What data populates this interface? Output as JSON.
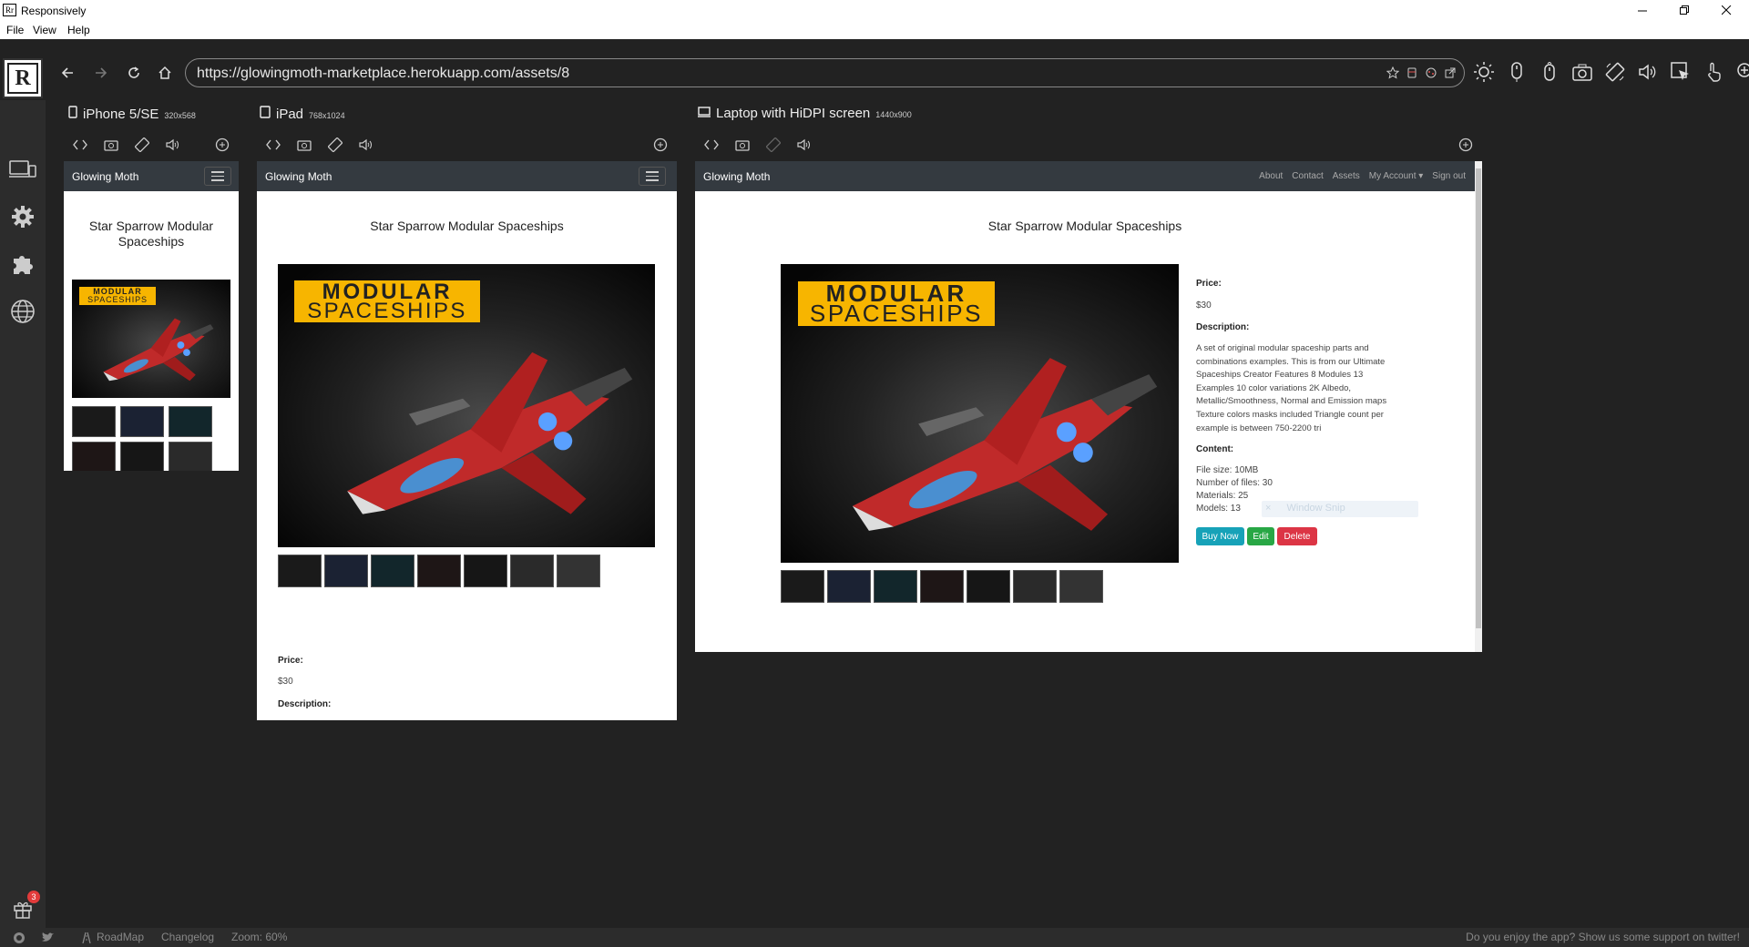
{
  "window": {
    "title": "Responsively",
    "app_icon_text": "Rr",
    "menu": [
      "File",
      "View",
      "Help"
    ]
  },
  "browser": {
    "url": "https://glowingmoth-marketplace.herokuapp.com/assets/8"
  },
  "status": {
    "roadmap": "RoadMap",
    "changelog": "Changelog",
    "zoom": "Zoom: 60%",
    "support": "Do you enjoy the app? Show us some support on twitter!"
  },
  "sidebar": {
    "gift_badge": "3"
  },
  "devices": [
    {
      "name": "iPhone 5/SE",
      "size": "320x568"
    },
    {
      "name": "iPad",
      "size": "768x1024"
    },
    {
      "name": "Laptop with HiDPI screen",
      "size": "1440x900"
    }
  ],
  "site": {
    "brand": "Glowing Moth",
    "nav_links": [
      "About",
      "Contact",
      "Assets",
      "My Account",
      "Sign out"
    ],
    "asset_title": "Star Sparrow Modular Spaceships",
    "banner_line1": "MODULAR",
    "banner_line2": "SPACESHIPS",
    "price_label": "Price:",
    "price": "$30",
    "description_label": "Description:",
    "description": "A set of original modular spaceship parts and combinations examples. This is from our Ultimate Spaceships Creator Features 8 Modules 13 Examples 10 color variations 2K Albedo, Metallic/Smoothness, Normal and Emission maps Texture colors masks included Triangle count per example is between 750-2200 tri",
    "content_label": "Content:",
    "file_size": "File size: 10MB",
    "num_files": "Number of files: 30",
    "materials": "Materials: 25",
    "models": "Models: 13",
    "window_snip": "Window Snip",
    "buy_label": "Buy Now",
    "edit_label": "Edit",
    "delete_label": "Delete"
  },
  "colors": {
    "navbar": "#343a40",
    "buy": "#17a2b8",
    "edit": "#28a745",
    "delete": "#dc3545",
    "banner": "#f7b500"
  }
}
